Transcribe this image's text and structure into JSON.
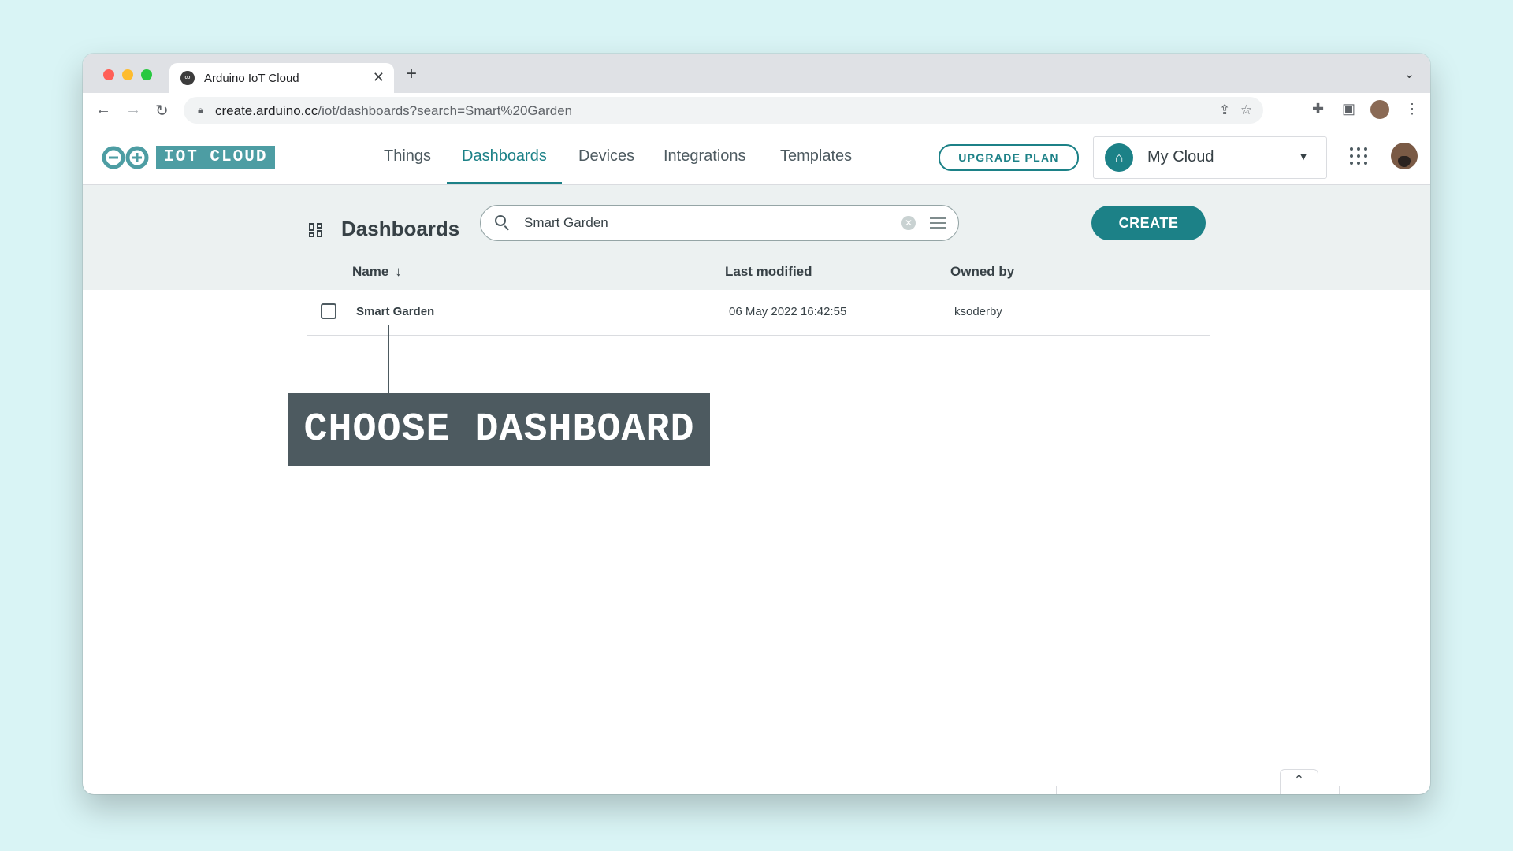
{
  "browser": {
    "tab_title": "Arduino IoT Cloud",
    "tab_close": "✕",
    "new_tab": "+",
    "url_host": "create.arduino.cc",
    "url_path": "/iot/dashboards?search=Smart%20Garden"
  },
  "header": {
    "logo_text": "IOT CLOUD",
    "nav": [
      "Things",
      "Dashboards",
      "Devices",
      "Integrations",
      "Templates"
    ],
    "active_nav": "Dashboards",
    "upgrade_label": "UPGRADE PLAN",
    "cloud_label": "My Cloud"
  },
  "toolbar": {
    "title": "Dashboards",
    "search_value": "Smart Garden",
    "create_label": "CREATE"
  },
  "table": {
    "columns": [
      "Name",
      "Last modified",
      "Owned by"
    ],
    "rows": [
      {
        "name": "Smart Garden",
        "modified": "06 May 2022 16:42:55",
        "owner": "ksoderby"
      }
    ]
  },
  "callout": {
    "text": "CHOOSE DASHBOARD"
  },
  "colors": {
    "page_bg": "#d9f4f5",
    "accent": "#1c8187",
    "logo": "#4d9da3",
    "callout_bg": "#4d5a60"
  }
}
